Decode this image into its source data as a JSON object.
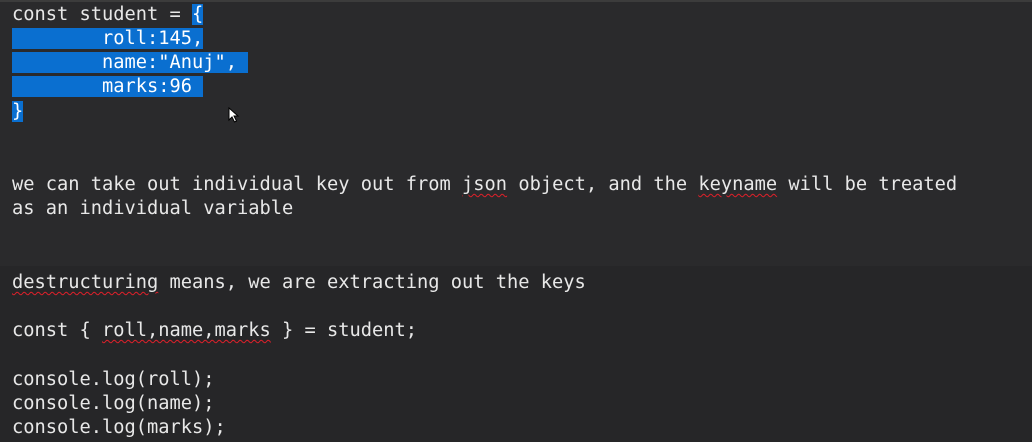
{
  "code_block": {
    "line1_pre": "const student = ",
    "line1_sel": "{",
    "line2": "        roll:145,",
    "line3": "        name:\"Anuj\", ",
    "line4": "        marks:96 ",
    "line5": "}"
  },
  "explanation": {
    "p1_a": "we can take out individual key out from ",
    "p1_json": "json",
    "p1_b": " object, and the ",
    "p1_keyname": "keyname",
    "p1_c": " will be treated",
    "p2": "as an individual variable"
  },
  "destructuring": {
    "word": "destructuring",
    "rest": " means, we are extracting out the keys"
  },
  "destructure_code": {
    "pre": "const { ",
    "vars": "roll,name,marks",
    "post": " } = student;"
  },
  "console_lines": [
    "console.log(roll);",
    "console.log(name);",
    "console.log(marks);"
  ],
  "colors": {
    "background": "#2a2a2c",
    "selection": "#0a6fd0",
    "text": "#e8e8e8",
    "spell_error": "#e0202a"
  },
  "icons": {
    "mouse_cursor": "arrow-pointer-icon"
  }
}
